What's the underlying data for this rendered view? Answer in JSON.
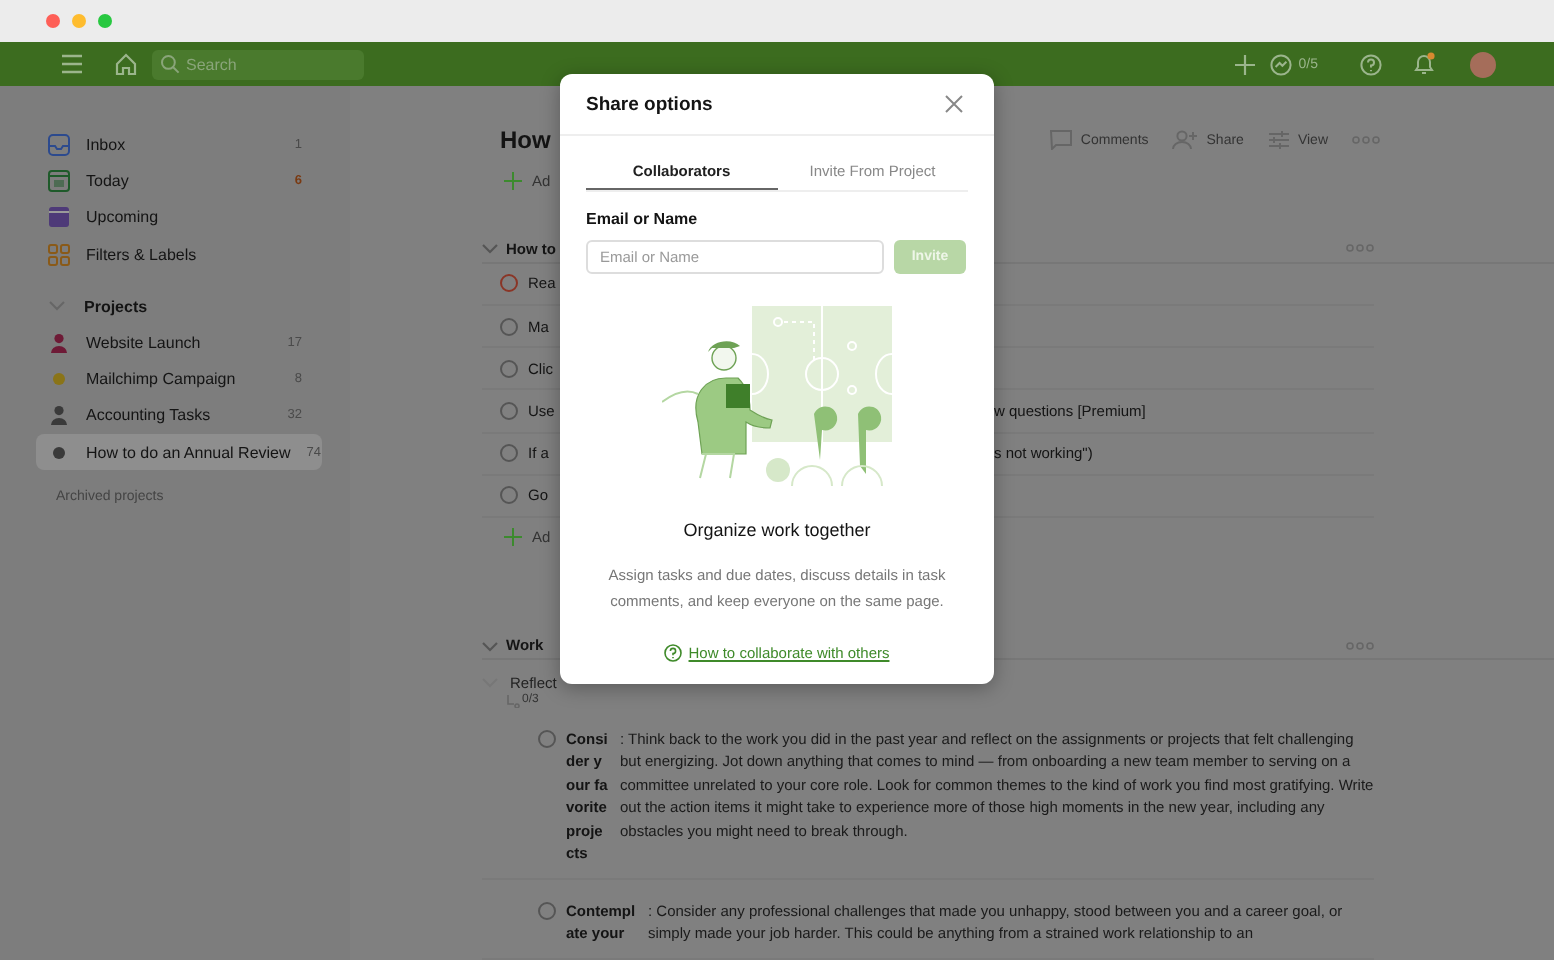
{
  "top_bar": {
    "search": {
      "placeholder": "Search"
    },
    "productivity": "0/5",
    "notifications": {
      "unread": true
    }
  },
  "sidebar": {
    "items": [
      {
        "kind": "inbox",
        "label": "Inbox",
        "count": "1",
        "highlight": false
      },
      {
        "kind": "today",
        "label": "Today",
        "count": "6",
        "highlight": true
      },
      {
        "kind": "upcoming",
        "label": "Upcoming"
      },
      {
        "kind": "filters",
        "label": "Filters & Labels"
      }
    ],
    "projects_header": {
      "label": "Projects",
      "expanded": true
    },
    "projects": [
      {
        "kind": "person",
        "name": "Website Launch",
        "count": "17",
        "color": "#6e1a36",
        "selected": false
      },
      {
        "kind": "dot",
        "name": "Mailchimp Campaign",
        "count": "8",
        "color": "#8a7418",
        "selected": false
      },
      {
        "kind": "person",
        "name": "Accounting Tasks",
        "count": "32",
        "color": "#3a3a3a",
        "selected": false
      },
      {
        "kind": "dot",
        "name": "How to do an Annual Review",
        "count": "74",
        "color": "#3a3a3a",
        "selected": true
      }
    ],
    "archived": "Archived projects"
  },
  "project": {
    "title": "How",
    "add_task": "Ad",
    "actions": [
      {
        "kind": "comments",
        "label": "Comments"
      },
      {
        "kind": "share",
        "label": "Share"
      },
      {
        "kind": "view",
        "label": "View"
      }
    ],
    "sections": [
      {
        "title": "How to",
        "expanded": true,
        "tasks": [
          {
            "left": "Rea",
            "color": "#8a3526"
          },
          {
            "left": "Ma",
            "color": "#555555"
          },
          {
            "left": "Clic",
            "color": "#555555"
          },
          {
            "left": "Use",
            "right": "w questions [Premium]",
            "color": "#555555"
          },
          {
            "left": "If a",
            "right": "s not working\")",
            "color": "#555555"
          },
          {
            "left": "Go",
            "color": "#555555"
          }
        ],
        "add_task": "Ad"
      },
      {
        "title": "Work",
        "expanded": true,
        "parent": {
          "title": "Reflect",
          "expanded": true,
          "subtasks": "0/3",
          "tasks": [
            {
              "title": "Consider your favorite projects",
              "checked": false,
              "description": ": Think back to the work you did in the past year and reflect on the assignments or projects that felt challenging but energizing. Jot down anything that comes to mind — from onboarding a new team member to serving on a committee unrelated to your core role. Look for common themes to the kind of work you find most gratifying. Write out the action items it might take to experience more of those high moments in the new year, including any obstacles you might need to break through."
            },
            {
              "title": "Contemplate your",
              "checked": false,
              "description": ": Consider any professional challenges that made you unhappy, stood between you and a career goal, or simply made your job harder. This could be anything from a strained work relationship to an"
            }
          ]
        }
      }
    ]
  },
  "dialog": {
    "title": "Share options",
    "tabs": [
      {
        "label": "Collaborators",
        "selected": true
      },
      {
        "label": "Invite From Project",
        "selected": false
      }
    ],
    "field_label": "Email or Name",
    "field": {
      "placeholder": "Email or Name"
    },
    "invite": {
      "label": "Invite",
      "disabled": true
    },
    "heading": "Organize work together",
    "body": "Assign tasks and due dates, discuss details in task comments, and keep everyone on the same page.",
    "link": "How to collaborate with others"
  }
}
